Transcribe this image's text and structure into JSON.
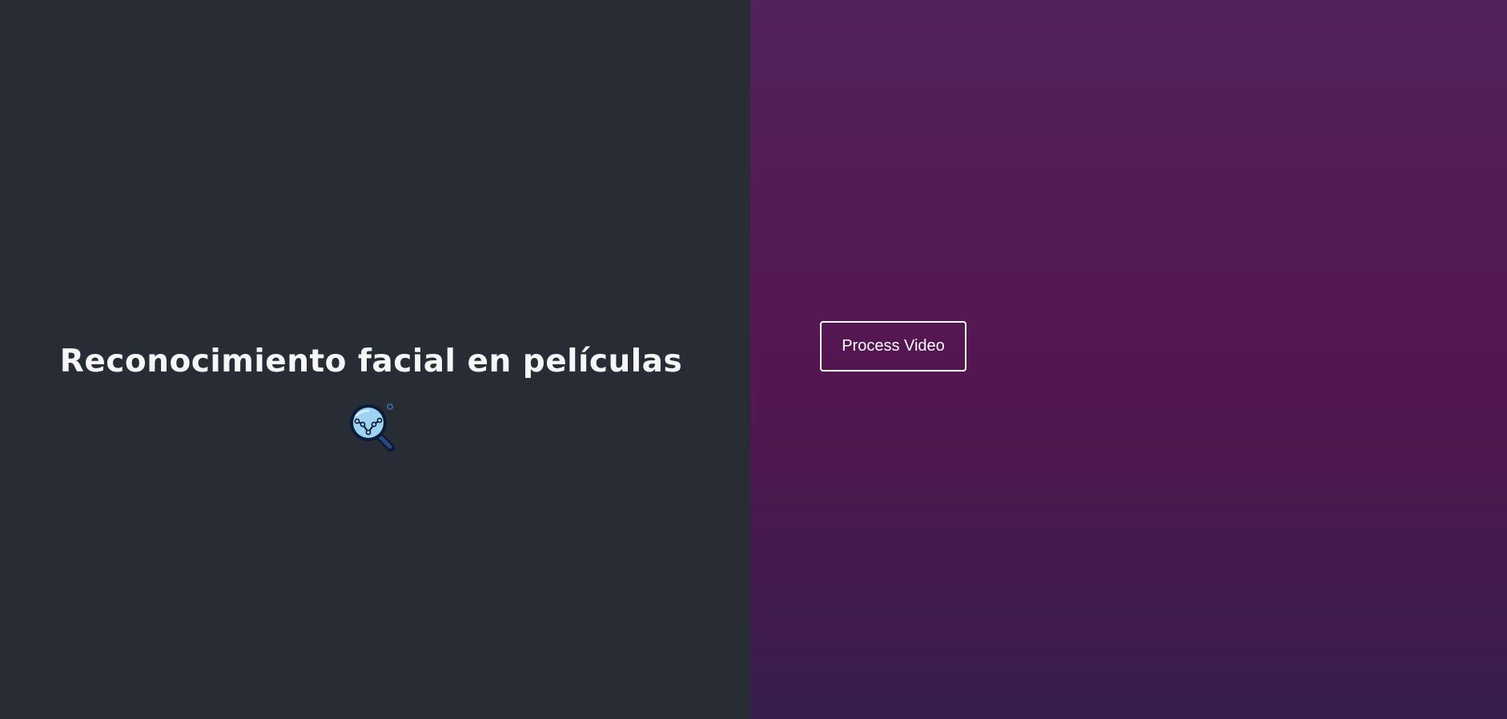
{
  "title": "Reconocimiento facial en películas",
  "logo": {
    "icon": "magnifier-chart-icon"
  },
  "actions": {
    "process_label": "Process Video"
  },
  "colors": {
    "left_panel_bg": "#282c34",
    "right_panel_top": "#52225c",
    "right_panel_mid": "#541650",
    "right_panel_bottom": "#371e4c",
    "title_text": "#f4f6f8",
    "button_border": "#ffffff",
    "icon_lens": "#9fd3f2",
    "icon_outline": "#0b1b38"
  }
}
